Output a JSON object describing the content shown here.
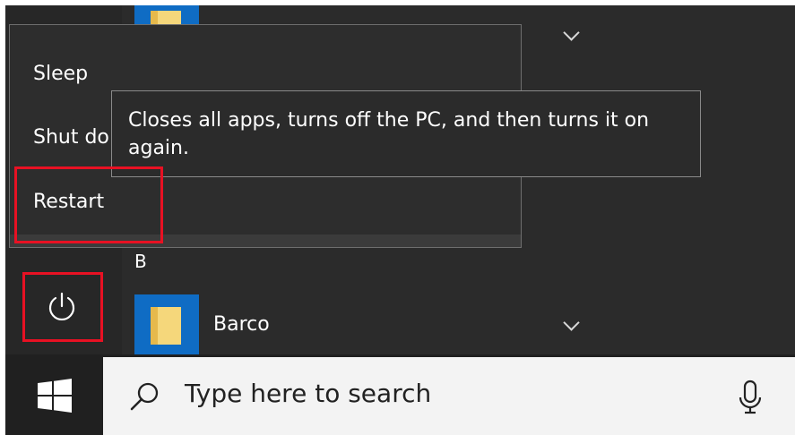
{
  "power_menu": {
    "items": [
      {
        "label": "Sleep"
      },
      {
        "label": "Shut do"
      },
      {
        "label": "Restart"
      }
    ]
  },
  "tooltip": {
    "text": "Closes all apps, turns off the PC, and then turns it on again."
  },
  "start_menu": {
    "section_letter": "B",
    "apps": [
      {
        "name": "Barco"
      }
    ]
  },
  "taskbar": {
    "search_placeholder": "Type here to search"
  },
  "icons": {
    "power": "power-icon",
    "windows": "windows-logo-icon",
    "search": "search-icon",
    "microphone": "microphone-icon",
    "folder": "folder-icon",
    "chevron": "chevron-down-icon"
  },
  "colors": {
    "highlight": "#e81123",
    "tile": "#0f6cc4",
    "menu_bg": "#2d2d2d",
    "taskbar_bg": "#202020",
    "search_bg": "#f3f3f3"
  }
}
